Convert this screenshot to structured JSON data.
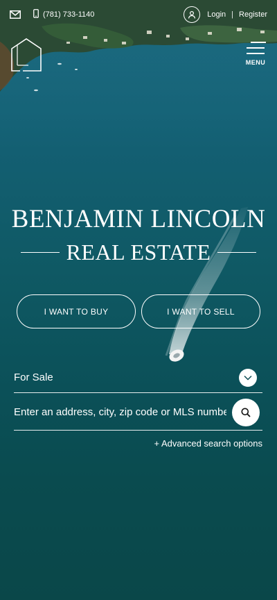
{
  "topbar": {
    "phone": "(781) 733-1140",
    "login": "Login",
    "separator": "|",
    "register": "Register"
  },
  "menu": {
    "label": "MENU"
  },
  "brand": {
    "line1": "BENJAMIN LINCOLN",
    "line2": "REAL ESTATE"
  },
  "cta": {
    "buy": "I WANT TO BUY",
    "sell": "I WANT TO SELL"
  },
  "search": {
    "type_value": "For Sale",
    "placeholder": "Enter an address, city, zip code or MLS number",
    "advanced": "+ Advanced search options"
  },
  "icons": {
    "mail": "mail-icon",
    "phone": "mobile-phone-icon",
    "user": "user-icon",
    "logo": "house-logo-icon",
    "menu": "hamburger-icon",
    "chevron": "chevron-down-icon",
    "search": "search-icon"
  },
  "colors": {
    "water_top": "#1d6f86",
    "water_bottom": "#0a4749",
    "text": "#ffffff"
  }
}
